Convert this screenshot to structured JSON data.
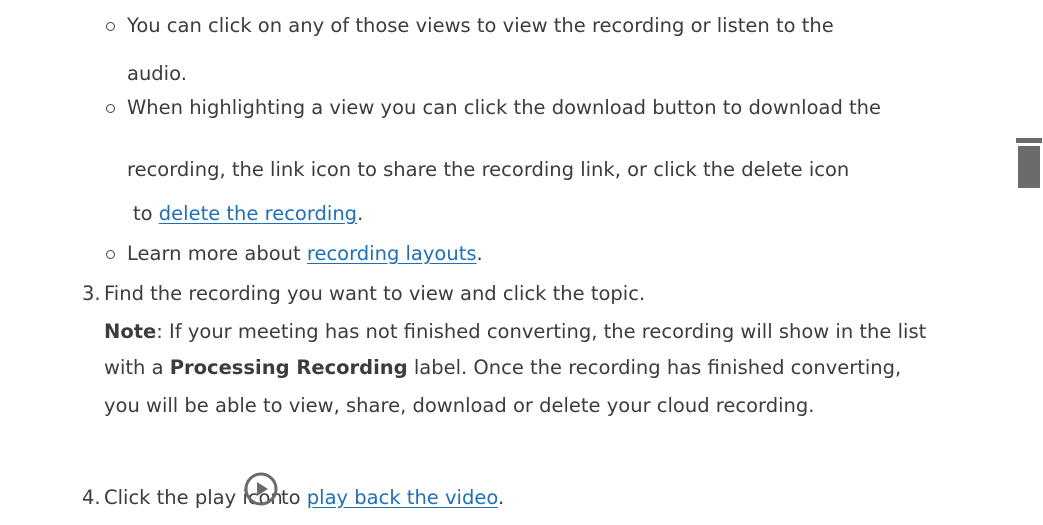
{
  "bullets": [
    {
      "line1": "You can click on any of those views to view the recording or listen to the",
      "line2": "audio."
    },
    {
      "line1": "When highlighting a view you can click the download button to download the",
      "line2": "recording, the link icon to share the recording link, or click the delete icon",
      "line3_before": "to ",
      "line3_link": "delete the recording",
      "line3_after": "."
    },
    {
      "before": "Learn more about ",
      "link": "recording layouts",
      "after": "."
    }
  ],
  "steps": {
    "step3": {
      "number": "3.",
      "text": "Find the recording you want to view and click the topic.",
      "note_label": "Note",
      "note_line1_rest": ": If your meeting has not finished converting, the recording will show in the list",
      "note_line2_before": "with a ",
      "note_line2_bold": "Processing Recording",
      "note_line2_after": " label. Once the recording has finished converting,",
      "note_line3": "you will be able to view, share, download or delete your cloud recording."
    },
    "step4": {
      "number": "4.",
      "before": "Click the play icon",
      "middle": "to ",
      "link": "play back the video",
      "after": "."
    }
  },
  "icons": {
    "trash": "trash-icon",
    "play": "play-icon"
  },
  "colors": {
    "text": "#3c3c3c",
    "link": "#1f6fb5",
    "icon": "#6b6b6b"
  }
}
